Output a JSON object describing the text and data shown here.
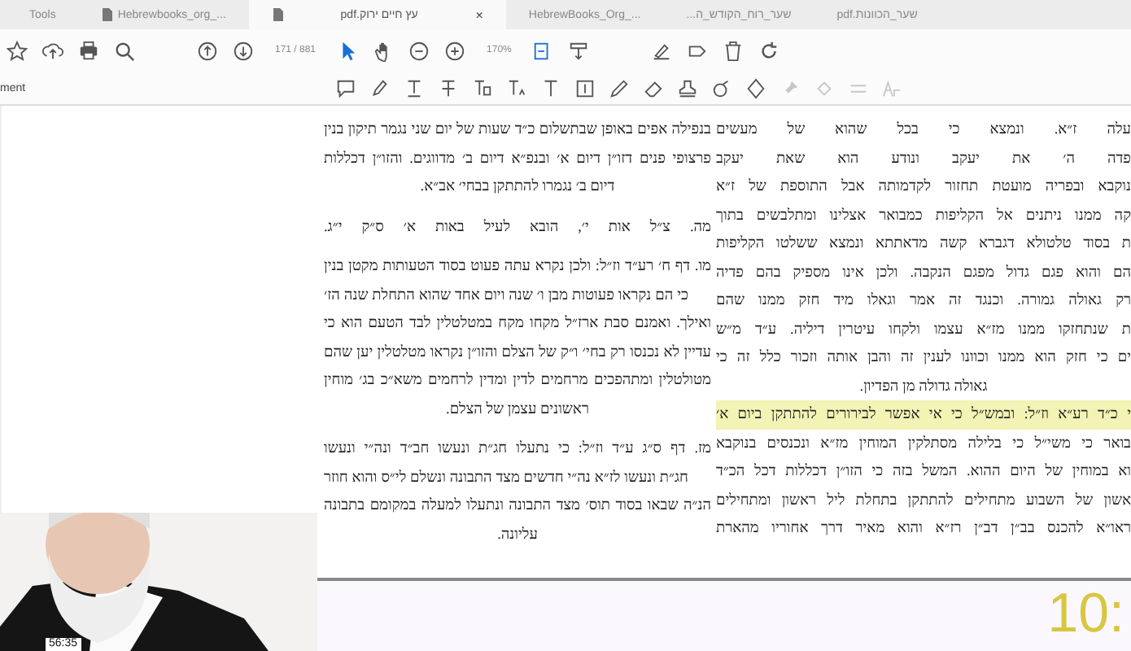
{
  "tabs": [
    {
      "label": "שער_הכוונות.pdf",
      "selected": false,
      "kind": "plain"
    },
    {
      "label": "שער_רוח_הקודש_ה...",
      "selected": false,
      "kind": "plain"
    },
    {
      "label": "HebrewBooks_Org_...",
      "selected": false,
      "kind": "plain"
    },
    {
      "label": "עץ חיים ירוק.pdf",
      "selected": true,
      "kind": "file",
      "close": "×"
    },
    {
      "label": "Hebrewbooks_org_...",
      "selected": false,
      "kind": "file"
    },
    {
      "label": "Tools",
      "selected": false,
      "kind": "plain"
    }
  ],
  "toolbar": {
    "page": "171 / 881",
    "zoom": "170%"
  },
  "comment_bar": {
    "label": "ment"
  },
  "document": {
    "left_column": [
      {
        "text": "בנפילה אפים באופן שבתשלום כ״ד שעות של יום שני נגמר תיקון בנין",
        "kind": "line"
      },
      {
        "text": "פרצופי פנים דזו״ן דיום א׳ ובנפ״א דיום ב׳ מדווגים. והזו״ן דכללות",
        "kind": "line"
      },
      {
        "text": "דיום ב׳ נגמרו להתתקן בבחי׳ אב״א.",
        "kind": "last"
      },
      {
        "text": "מה. צ״ל אות י׳, הובא לעיל באות א׳ ס״ק י״ג.",
        "kind": "para"
      },
      {
        "text": "מו. דף ח׳ רע״ד וז״ל: ולכן נקרא עתה פעוט בסוד הטעותות מקטן בנין",
        "kind": "para"
      },
      {
        "text": "כי הם נקראו פעוטות מבן ו׳ שנה ויום אחד שהוא התחלת שנה הז׳",
        "kind": "indent"
      },
      {
        "text": "ואילך. ואמנם סבת ארז״ל מקחו מקח במטלטלין לבד הטעם הוא כי",
        "kind": "line"
      },
      {
        "text": "עדיין לא נכנסו רק בחי׳ ו״ק של הצלם והזו״ן נקראו מטלטלין יען שהם",
        "kind": "line"
      },
      {
        "text": "מטולטלין ומתהפכים מרחמים לדין ומדין לרחמים משא״כ בג׳ מוחין",
        "kind": "line"
      },
      {
        "text": "ראשונים עצמן של הצלם.",
        "kind": "last"
      },
      {
        "text": "מז. דף ס״ג ע״ד וז״ל: כי נתעלו חג״ת ונעשו חב״ד ונה״י ונעשו",
        "kind": "para"
      },
      {
        "text": "חג״ת ונעשו לז״א נה״י חדשים מצד התבונה ונשלם לי״ס והוא חוזר",
        "kind": "indent"
      },
      {
        "text": "הנ״ה שבאו בסוד תוס׳ מצד התבונה ונתעלו למעלה במקומם בתבונה",
        "kind": "line"
      },
      {
        "text": "עליונה.",
        "kind": "last"
      }
    ],
    "right_column": [
      {
        "text": "עלה ז״א. ונמצא כי בכל שהוא של מעשים",
        "kind": "line",
        "highlighted": false
      },
      {
        "text": "פדה ה׳ את יעקב ונודע הוא שאת יעקב",
        "kind": "line",
        "highlighted": false
      },
      {
        "text": "נוקבא ובפריה מועטת תחזור לקדמותה אבל התוספת של ז״א",
        "kind": "line",
        "highlighted": false
      },
      {
        "text": "קה ממנו ניתנים אל הקליפות כמבואר אצלינו ומתלבשים בתוך",
        "kind": "line",
        "highlighted": false
      },
      {
        "text": "ת בסוד טלטולא דגברא קשה מדאתתא ונמצא ששלטו הקליפות",
        "kind": "line",
        "highlighted": false
      },
      {
        "text": "הם והוא פגם גדול מפגם הנקבה. ולכן אינו מספיק בהם פדיה",
        "kind": "line",
        "highlighted": false
      },
      {
        "text": "רק גאולה גמורה. וכנגד זה אמר וגאלו מיד חזק ממנו שהם",
        "kind": "line",
        "highlighted": false
      },
      {
        "text": "ת שנתחזקו ממנו מז״א עצמו ולקחו עיטרין דיליה. ע״ד מ״ש",
        "kind": "line",
        "highlighted": false
      },
      {
        "text": "ים כי חזק הוא ממנו וכוונו לענין זה והבן אותה וזכור כלל זה כי",
        "kind": "line",
        "highlighted": false
      },
      {
        "text": "גאולה גדולה מן הפדיון.",
        "kind": "last",
        "highlighted": false
      },
      {
        "text": "י כ״ד רע״א וז״ל: ובמש״ל כי אי אפשר לבירורים להתתקן ביום א׳",
        "kind": "line",
        "highlighted": true
      },
      {
        "text": "בואר כי משי״ל כי בלילה מסתלקין המוחין מז״א ונכנסים בנוקבא",
        "kind": "line",
        "highlighted": false
      },
      {
        "text": "וא במוחין של היום ההוא. המשל בזה כי הזו״ן דכללות דכל הכ״ד",
        "kind": "line",
        "highlighted": false
      },
      {
        "text": "אשון של השבוע מתחילים להתתקן בתחלת ליל ראשון ומתחילים",
        "kind": "line",
        "highlighted": false
      },
      {
        "text": "ראו״א להכנס בב״ן דב״ן רז״א והוא מאיר דרך אחוריו מהארת",
        "kind": "line",
        "highlighted": false
      }
    ]
  },
  "video": {
    "kind": "picture",
    "time": "56:35"
  },
  "clock": {
    "text": "10:"
  }
}
